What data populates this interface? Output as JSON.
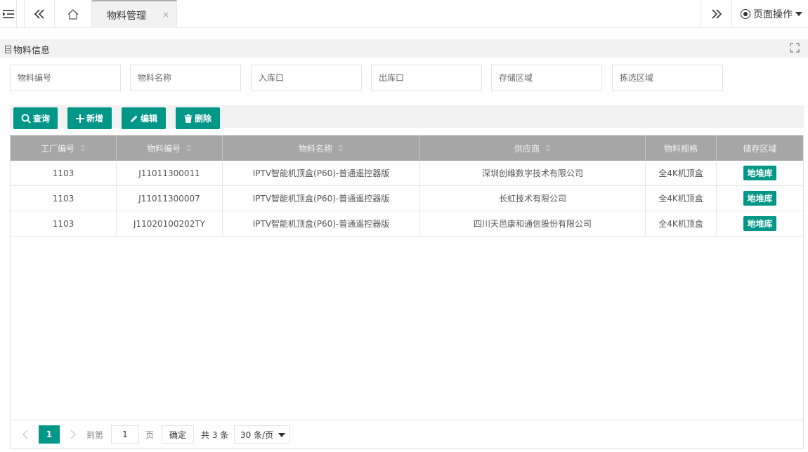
{
  "topbar": {
    "tab_label": "物料管理",
    "tab_close": "×",
    "page_ops_label": "页面操作"
  },
  "panel": {
    "title": "物料信息"
  },
  "filters": {
    "material_code": "物料编号",
    "material_name": "物料名称",
    "inbound_port": "入库口",
    "outbound_port": "出库口",
    "storage_area": "存储区域",
    "picking_area": "拣选区域"
  },
  "toolbar": {
    "query_label": "查询",
    "add_label": "新增",
    "edit_label": "编辑",
    "delete_label": "删除"
  },
  "table": {
    "columns": [
      "工厂编号",
      "物料编号",
      "物料名称",
      "供应商",
      "物料规格",
      "储存区域"
    ],
    "rows": [
      {
        "factory": "1103",
        "code": "J11011300011",
        "name": "IPTV智能机顶盒(P60)-普通遥控器版",
        "supplier": "深圳创维数字技术有限公司",
        "spec": "全4K机顶盒",
        "area": "地堆库"
      },
      {
        "factory": "1103",
        "code": "J11011300007",
        "name": "IPTV智能机顶盒(P60)-普通遥控器版",
        "supplier": "长虹技术有限公司",
        "spec": "全4K机顶盒",
        "area": "地堆库"
      },
      {
        "factory": "1103",
        "code": "J11020100202TY",
        "name": "IPTV智能机顶盒(P60)-普通遥控器版",
        "supplier": "四川天邑康和通信股份有限公司",
        "spec": "全4K机顶盒",
        "area": "地堆库"
      }
    ]
  },
  "pager": {
    "current_page": "1",
    "goto_label": "到第",
    "goto_value": "1",
    "page_unit": "页",
    "confirm_label": "确定",
    "total_label": "共 3 条",
    "page_size": "30 条/页"
  },
  "colors": {
    "accent": "#009688",
    "header_bg": "#a6a6a6"
  }
}
